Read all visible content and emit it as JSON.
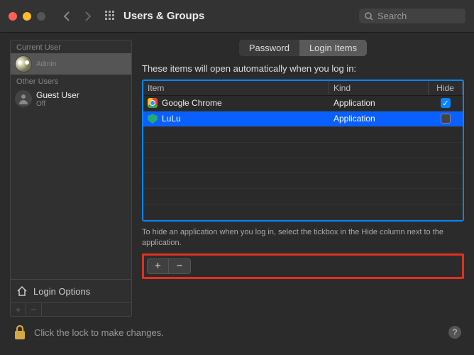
{
  "window": {
    "title": "Users & Groups",
    "search_placeholder": "Search"
  },
  "sidebar": {
    "current_label": "Current User",
    "other_label": "Other Users",
    "users": [
      {
        "name": "",
        "sub": "Admin",
        "selected": true,
        "avatar": "owl"
      },
      {
        "name": "Guest User",
        "sub": "Off",
        "selected": false,
        "avatar": "silhouette"
      }
    ],
    "login_options_label": "Login Options"
  },
  "tabs": {
    "password": "Password",
    "login_items": "Login Items",
    "active": "login_items"
  },
  "main": {
    "description": "These items will open automatically when you log in:",
    "columns": {
      "item": "Item",
      "kind": "Kind",
      "hide": "Hide"
    },
    "rows": [
      {
        "icon": "chrome",
        "name": "Google Chrome",
        "kind": "Application",
        "hide_checked": true,
        "selected": false
      },
      {
        "icon": "shield",
        "name": "LuLu",
        "kind": "Application",
        "hide_checked": false,
        "selected": true
      }
    ],
    "hint": "To hide an application when you log in, select the tickbox in the Hide column next to the application."
  },
  "footer": {
    "lock_text": "Click the lock to make changes."
  }
}
